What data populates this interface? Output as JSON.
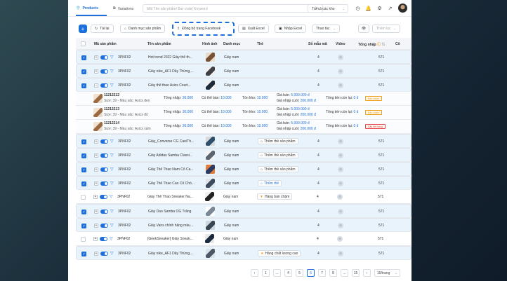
{
  "nav": {
    "tabs": [
      {
        "label": "Products",
        "icon": "shirt-icon"
      },
      {
        "label": "Variations",
        "icon": "layers-icon"
      }
    ],
    "search_placeholder": "Mã/ Tên sản phẩm/ Bar code/ Keyword",
    "warehouse": "Tất cả các kho"
  },
  "toolbar": {
    "reload": "Tải lại",
    "category": "Danh mục sản phẩm",
    "sync_facebook": "Đồng bộ trang Facebook",
    "export_excel": "Xuất Excel",
    "import_excel": "Nhập Excel",
    "actions": "Thao tác",
    "filter_placeholder": "Thêm lọc"
  },
  "columns": {
    "code": "Mã sản phẩm",
    "name": "Tên sản phẩm",
    "image": "Hình ảnh",
    "category": "Danh mục",
    "tags": "Thẻ",
    "variant_count": "Số mẫu mã",
    "video": "Video",
    "total_import": "Tổng nhập",
    "extra": "Cô"
  },
  "rows": [
    {
      "code": "3PNF02",
      "name": "Hot trend 2022 Giày thể th...",
      "category": "Giày nam",
      "tag": "",
      "count": "4",
      "total": "571",
      "checked": true,
      "expanded": false
    },
    {
      "code": "3PNF02",
      "name": "Giày nike_AF1 Dây Thừng,...",
      "category": "Giày nam",
      "tag": "",
      "count": "4",
      "total": "571",
      "checked": true,
      "expanded": false
    },
    {
      "code": "3PNF02",
      "name": "Giày thể thao Asics Court...",
      "category": "Giày nam",
      "tag": "",
      "count": "4",
      "total": "571",
      "checked": true,
      "expanded": true
    },
    {
      "code": "3PNF02",
      "name": "Giày_Converse CG Cao/Th...",
      "category": "Giày nam",
      "tag": "Thêm thẻ sản phẩm",
      "count": "4",
      "total": "571",
      "checked": true,
      "expanded": false
    },
    {
      "code": "3PNF02",
      "name": "Giày Adidas Samba Classi...",
      "category": "Giày nam",
      "tag": "Thêm thẻ sản phẩm",
      "count": "4",
      "total": "571",
      "checked": true,
      "expanded": false
    },
    {
      "code": "3PNF02",
      "name": "Giày Thể Thao Nam Cổ Ca...",
      "category": "Giày nam",
      "tag": "Thêm thẻ sản phẩm",
      "count": "4",
      "total": "571",
      "checked": true,
      "expanded": false
    },
    {
      "code": "3PNF02",
      "name": "Giày Thể Thao Cao Cổ Chỏ...",
      "category": "Giày nam",
      "tag": "Thêm thẻ",
      "count": "4",
      "total": "571",
      "checked": true,
      "expanded": false
    },
    {
      "code": "3PNF02",
      "name": "Giày Thể Thao Sneaker Na...",
      "category": "Giày nam",
      "tag": "Hàng bán chậm",
      "count": "4",
      "total": "571",
      "checked": false,
      "expanded": false
    },
    {
      "code": "3PNF02",
      "name": "Giày Dao Samba OG Trắng",
      "category": "Giày nam",
      "tag": "",
      "count": "4",
      "total": "571",
      "checked": true,
      "expanded": false
    },
    {
      "code": "3PNF02",
      "name": "Giày Vans chính hãng màu...",
      "category": "Giày nam",
      "tag": "",
      "count": "4",
      "total": "571",
      "checked": true,
      "expanded": false
    },
    {
      "code": "3PNF02",
      "name": "[GeekSneaker] Giày Sneak...",
      "category": "Giày nam",
      "tag": "",
      "count": "4",
      "total": "571",
      "checked": false,
      "expanded": false
    },
    {
      "code": "3PNF02",
      "name": "Giày nike_AF1 Dây Thừng,...",
      "category": "Giày nam",
      "tag": "Hàng chất lượng cao",
      "count": "4",
      "total": "571",
      "checked": true,
      "expanded": false
    }
  ],
  "variants": [
    {
      "sku": "11212212",
      "attr": "Size: 39 - Màu sắc: Asics đen",
      "import_label": "Tổng nhập:",
      "import": "30.000",
      "sellable_label": "Có thể bán:",
      "sellable": "10.000",
      "stock_label": "Tồn kho:",
      "stock": "10.000",
      "price_label": "Giá bán:",
      "price": "5.000.000 đ",
      "cost_label": "Giá nhập cuối:",
      "cost": "200.000 đ",
      "remain_label": "Tổng tiền còn lại:",
      "remain": "0 đ",
      "badge": "Bán chậm",
      "badge_color": "#f0a020"
    },
    {
      "sku": "11212213",
      "attr": "Size: 39 - Màu sắc: Asics đỏ",
      "import_label": "Tổng nhập:",
      "import": "30.000",
      "sellable_label": "Có thể bán:",
      "sellable": "10.000",
      "stock_label": "Tồn kho:",
      "stock": "10.000",
      "price_label": "Giá bán:",
      "price": "5.000.000 đ",
      "cost_label": "Giá nhập cuối:",
      "cost": "200.000 đ",
      "remain_label": "Tổng tiền còn lại:",
      "remain": "0 đ",
      "badge": "Bán chậm",
      "badge_color": "#f0a020"
    },
    {
      "sku": "11212214",
      "attr": "Size: 39 - Màu sắc: Asics xám",
      "import_label": "Tổng nhập:",
      "import": "30.000",
      "sellable_label": "Có thể bán:",
      "sellable": "10.000",
      "stock_label": "Tồn kho:",
      "stock": "10.000",
      "price_label": "Giá bán:",
      "price": "5.000.000 đ",
      "cost_label": "Giá nhập cuối:",
      "cost": "200.000 đ",
      "remain_label": "Tổng tiền còn lại:",
      "remain": "0 đ",
      "badge": "Sắp hết hàng",
      "badge_color": "#e5484d"
    }
  ],
  "pagination": {
    "pages": [
      "1",
      "...",
      "4",
      "5",
      "6",
      "7",
      "8",
      "...",
      "15"
    ],
    "current": "6",
    "page_size": "15/trang"
  },
  "colors": {
    "primary": "#1e6fd9",
    "selected_row": "#e9f3fb"
  }
}
